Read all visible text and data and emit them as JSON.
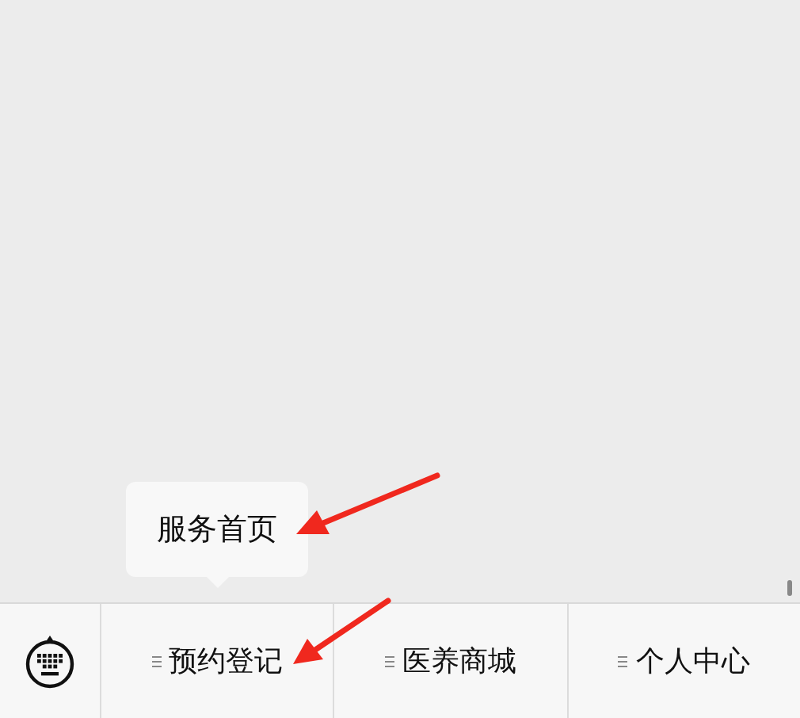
{
  "menu": [
    {
      "label": "预约登记",
      "submenu": [
        "服务首页"
      ]
    },
    {
      "label": "医养商城"
    },
    {
      "label": "个人中心"
    }
  ]
}
